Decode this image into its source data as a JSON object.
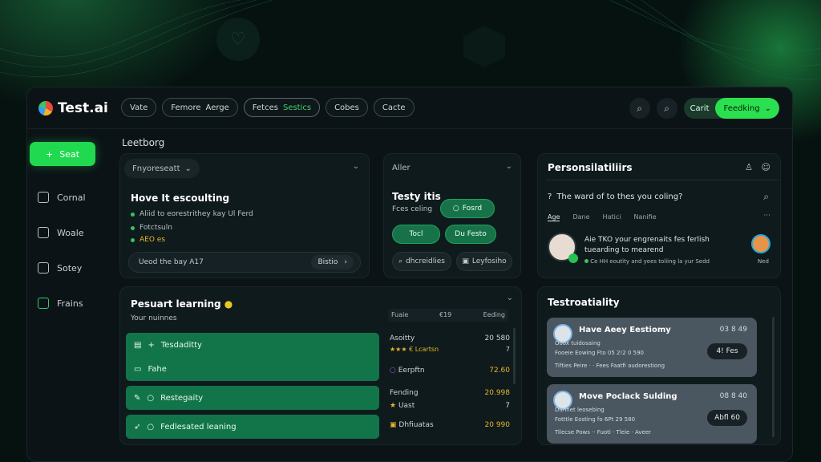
{
  "app": {
    "name": "Test.ai"
  },
  "topbar": {
    "tabs": [
      {
        "label": "Vate",
        "sub": ""
      },
      {
        "label": "Femore",
        "sub": "Aerge"
      },
      {
        "label": "Fetces",
        "sub": "Sestics"
      },
      {
        "label": "Cobes",
        "sub": ""
      },
      {
        "label": "Cacte",
        "sub": ""
      }
    ],
    "cart_label": "Carit",
    "action_label": "Feedking"
  },
  "sidebar": {
    "start_label": "Seat",
    "items": [
      "Cornal",
      "Woale",
      "Sotey",
      "Frains"
    ]
  },
  "main": {
    "section_title": "Leetborg"
  },
  "card1": {
    "select": "Fnyoreseatt",
    "title": "Hove It escoulting",
    "line1": "Aliid to eorestrithey kay Ul Ferd",
    "line2": "Fotctsuln",
    "line3": "AEO es",
    "footer_text": "Ueod the bay A17",
    "footer_btn": "Bistio"
  },
  "card2": {
    "select": "Aller",
    "title": "Testy itis",
    "subtitle": "Fces celing",
    "pill1": "Fosrd",
    "pill2": "Tocl",
    "pill3": "Du Festo",
    "pill4": "dhcreidlies",
    "pill5": "Leyfosiho"
  },
  "card3": {
    "title": "Pesuart learning",
    "subtitle": "Your nuinnes",
    "rows": [
      "Tesdaditty",
      "Fahe",
      "Restegaity",
      "Fedlesated leaning"
    ],
    "table_headers": [
      "Fuaie",
      "€19",
      "Eeding"
    ],
    "table_rows": [
      {
        "name": "Asoitty",
        "sub": "€ Lcartsn",
        "value": "20 580",
        "value2": "7"
      },
      {
        "name": "Eerpftn",
        "sub": "",
        "value": "72.60",
        "value2": ""
      },
      {
        "name": "Fending",
        "sub": "Uast",
        "value": "20.998",
        "value2": "7"
      },
      {
        "name": "Dhfiuatas",
        "sub": "",
        "value": "20 990",
        "value2": ""
      }
    ]
  },
  "card4": {
    "title": "Personsilatiliirs",
    "question": "The ward of to thes you coling?",
    "tabs": [
      "Age",
      "Dane",
      "Hatici",
      "Nanifie"
    ],
    "msg_line1": "Aie TKO your engrenaits fes ferlish",
    "msg_line2": "tuearding to mearend",
    "msg_line3": "Ce HH eoutity and yees toliing la yur Sedd",
    "right_label": "Ned"
  },
  "card5": {
    "title": "Testroatiality",
    "items": [
      {
        "title": "Have Aeey Eestiomy",
        "line1": "Ooox tuidosaing",
        "line2": "Fooeie Eowing Fto 05 2!2 0 590",
        "line3": "Tifties Peire · · Fees Faatfi audorestiong",
        "num": "03 8 49",
        "btn": "4! Fes"
      },
      {
        "title": "Move Poclack Sulding",
        "line1": "Dunnet leosebing",
        "line2": "Fotttle Eosting fo 6Pt 29 580",
        "line3": "Tilecse Pows ·· Fuoti · Tleie · Aveer",
        "num": "08 8 40",
        "btn": "Abfl 60"
      }
    ]
  }
}
